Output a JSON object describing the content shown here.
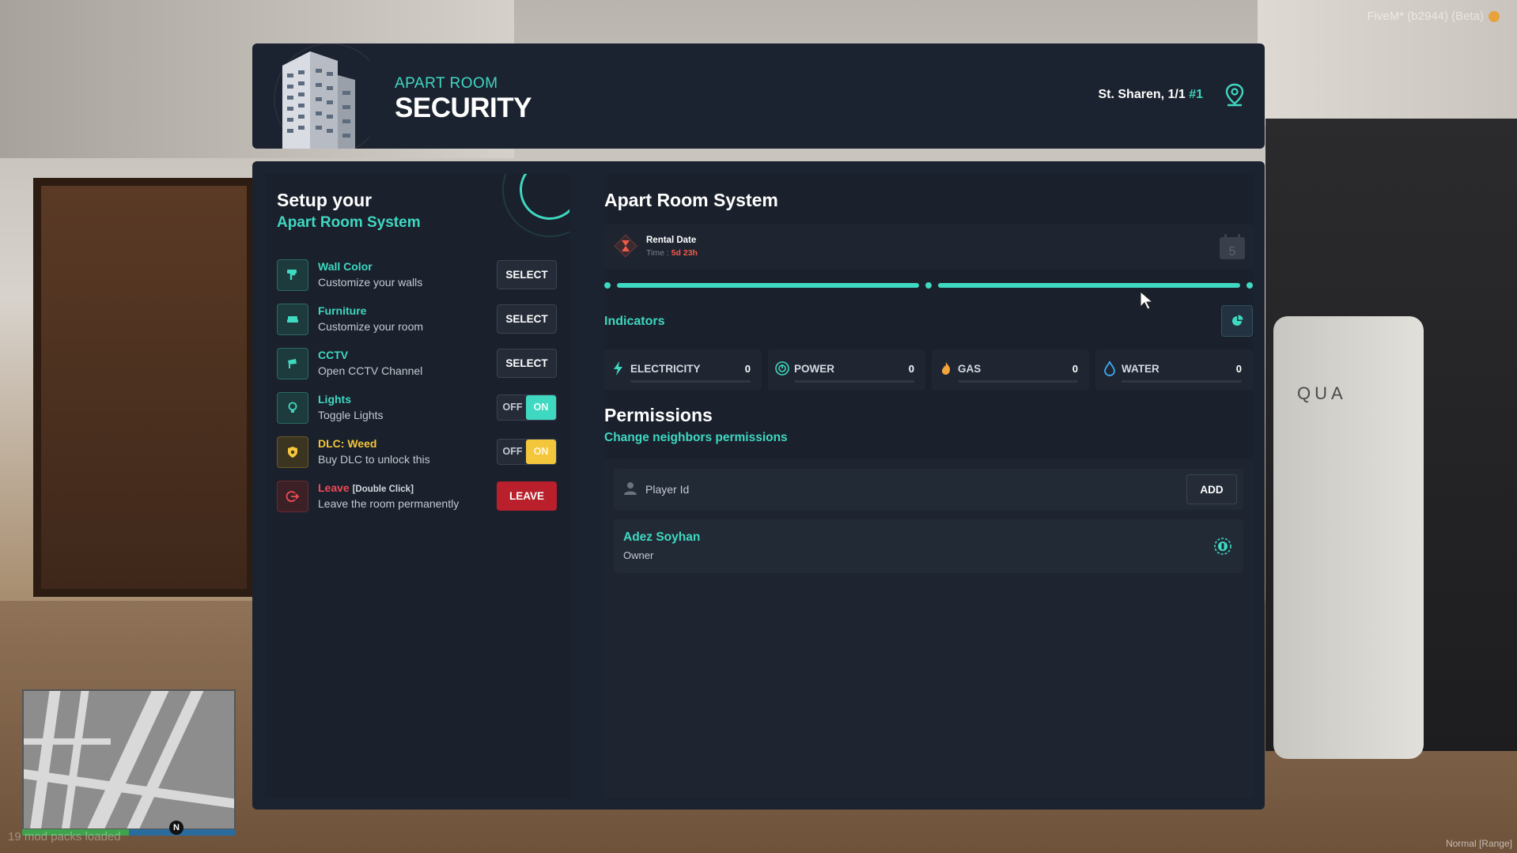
{
  "scene": {
    "fivem_label": "FiveM* (b2944) (Beta)",
    "mods_label": "19 mod packs loaded",
    "range_label": "Normal [Range]",
    "fridge_brand": "QUA",
    "compass": "N"
  },
  "header": {
    "subtitle": "APART ROOM",
    "title": "SECURITY",
    "location": "St. Sharen, 1/1",
    "room_number": "#1"
  },
  "setup": {
    "title": "Setup your",
    "subtitle": "Apart Room System",
    "options": [
      {
        "name": "Wall Color",
        "desc": "Customize your walls",
        "action": "SELECT",
        "icon": "paint-roller-icon"
      },
      {
        "name": "Furniture",
        "desc": "Customize your room",
        "action": "SELECT",
        "icon": "sofa-icon"
      },
      {
        "name": "CCTV",
        "desc": "Open CCTV Channel",
        "action": "SELECT",
        "icon": "cctv-camera-icon"
      },
      {
        "name": "Lights",
        "desc": "Toggle Lights",
        "off_label": "OFF",
        "on_label": "ON",
        "state": "on",
        "icon": "lightbulb-icon"
      },
      {
        "name": "DLC: Weed",
        "desc": "Buy DLC to unlock this",
        "off_label": "OFF",
        "on_label": "ON",
        "state": "on",
        "icon": "shield-leaf-icon"
      },
      {
        "name": "Leave",
        "name_extra": "[Double Click]",
        "desc": "Leave the room permanently",
        "action": "LEAVE",
        "icon": "exit-icon"
      }
    ]
  },
  "system": {
    "title": "Apart Room System",
    "rental": {
      "label": "Rental Date",
      "time_prefix": "Time :",
      "time_value": "5d 23h",
      "calendar_day": "5"
    },
    "indicators_title": "Indicators",
    "meters": [
      {
        "label": "ELECTRICITY",
        "value": "0",
        "level": 0,
        "icon": "lightning-icon",
        "color": "#3fd8c1"
      },
      {
        "label": "POWER",
        "value": "0",
        "level": 0,
        "icon": "power-icon",
        "color": "#3fd8c1"
      },
      {
        "label": "GAS",
        "value": "0",
        "level": 0,
        "icon": "flame-icon",
        "color": "#f3a53c"
      },
      {
        "label": "WATER",
        "value": "0",
        "level": 0,
        "icon": "water-drop-icon",
        "color": "#3fa8f0"
      }
    ]
  },
  "permissions": {
    "title": "Permissions",
    "subtitle": "Change neighbors permissions",
    "player_placeholder": "Player Id",
    "add_label": "ADD",
    "members": [
      {
        "name": "Adez Soyhan",
        "role": "Owner"
      }
    ]
  },
  "colors": {
    "accent": "#3fd8c1",
    "panel": "#1c2330",
    "danger": "#b9202b",
    "warning": "#f3c63c"
  }
}
